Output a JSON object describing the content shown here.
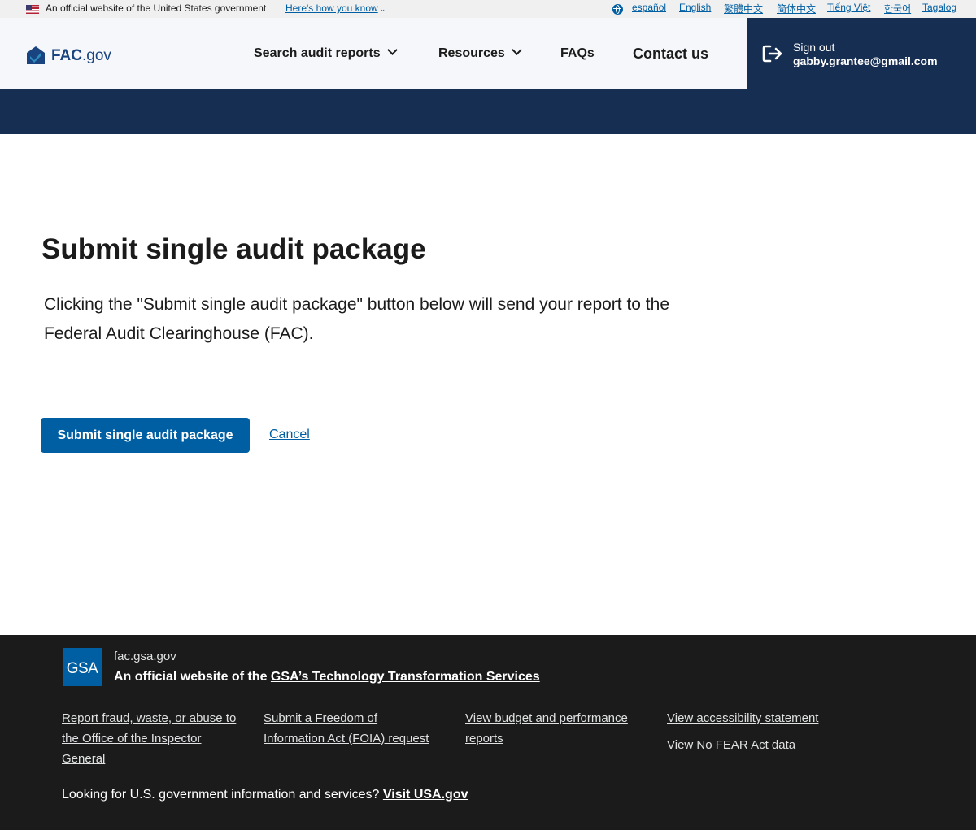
{
  "gov_banner": {
    "text": "An official website of the United States government",
    "link": "Here's how you know",
    "languages": [
      "español",
      "English",
      "繁體中文",
      "简体中文",
      "Tiếng Việt",
      "한국어",
      "Tagalog"
    ]
  },
  "header": {
    "logo_fac": "FAC",
    "logo_gov": ".gov",
    "nav": {
      "search": "Search audit reports",
      "resources": "Resources",
      "faqs": "FAQs",
      "contact": "Contact us"
    },
    "signout": {
      "label": "Sign out",
      "email": "gabby.grantee@gmail.com"
    }
  },
  "main": {
    "title": "Submit single audit package",
    "intro": "Clicking the \"Submit single audit package\" button below will send your report to the Federal Audit Clearinghouse (FAC).",
    "submit_label": "Submit single audit package",
    "cancel_label": "Cancel"
  },
  "footer": {
    "logo_text": "GSA",
    "site": "fac.gsa.gov",
    "official_prefix": "An official website of the ",
    "official_link": "GSA’s Technology Transformation Services",
    "links": [
      "Report fraud, waste, or abuse to the Office of the Inspector General",
      "Submit a Freedom of Information Act (FOIA) request",
      "View budget and performance reports",
      "View accessibility statement",
      "View No FEAR Act data"
    ],
    "looking_prefix": "Looking for U.S. government information and services? ",
    "looking_link": "Visit USA.gov"
  },
  "colors": {
    "primary": "#005ea2",
    "navy": "#162e51",
    "footer_bg": "#1b1b1b"
  }
}
